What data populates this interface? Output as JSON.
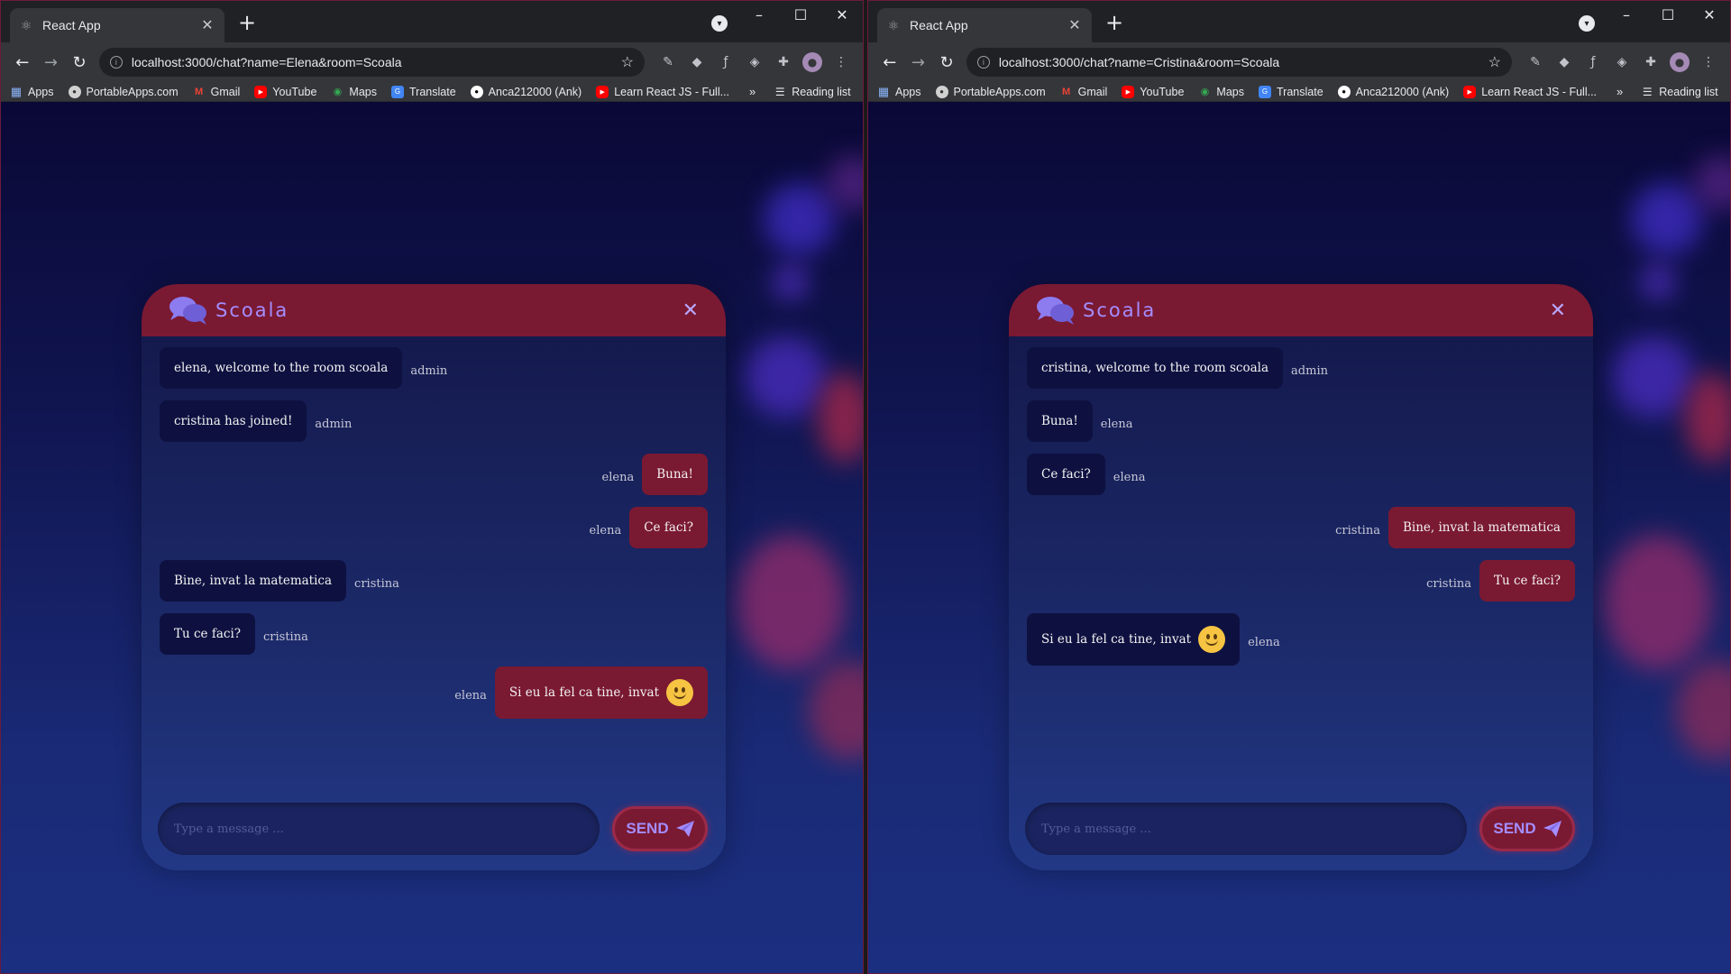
{
  "left": {
    "tab_title": "React App",
    "url": "localhost:3000/chat?name=Elena&room=Scoala",
    "bookmarks": [
      "Apps",
      "PortableApps.com",
      "Gmail",
      "YouTube",
      "Maps",
      "Translate",
      "Anca212000 (Ank)",
      "Learn React JS - Full..."
    ],
    "reading_list": "Reading list",
    "room": "Scoala",
    "messages": [
      {
        "text": "elena, welcome to the room scoala",
        "sender": "admin",
        "mine": false
      },
      {
        "text": "cristina has joined!",
        "sender": "admin",
        "mine": false
      },
      {
        "text": "Buna!",
        "sender": "elena",
        "mine": true
      },
      {
        "text": "Ce faci?",
        "sender": "elena",
        "mine": true
      },
      {
        "text": "Bine, invat la matematica",
        "sender": "cristina",
        "mine": false
      },
      {
        "text": "Tu ce faci?",
        "sender": "cristina",
        "mine": false
      },
      {
        "text": "Si eu la fel ca tine, invat",
        "sender": "elena",
        "mine": true,
        "emoji": "slightly-smiling-face"
      }
    ],
    "input_placeholder": "Type a message ...",
    "send_label": "SEND"
  },
  "right": {
    "tab_title": "React App",
    "url": "localhost:3000/chat?name=Cristina&room=Scoala",
    "bookmarks": [
      "Apps",
      "PortableApps.com",
      "Gmail",
      "YouTube",
      "Maps",
      "Translate",
      "Anca212000 (Ank)",
      "Learn React JS - Full..."
    ],
    "reading_list": "Reading list",
    "room": "Scoala",
    "messages": [
      {
        "text": "cristina, welcome to the room scoala",
        "sender": "admin",
        "mine": false
      },
      {
        "text": "Buna!",
        "sender": "elena",
        "mine": false
      },
      {
        "text": "Ce faci?",
        "sender": "elena",
        "mine": false
      },
      {
        "text": "Bine, invat la matematica",
        "sender": "cristina",
        "mine": true
      },
      {
        "text": "Tu ce faci?",
        "sender": "cristina",
        "mine": true
      },
      {
        "text": "Si eu la fel ca tine, invat",
        "sender": "elena",
        "mine": false,
        "emoji": "slightly-smiling-face"
      }
    ],
    "input_placeholder": "Type a message ...",
    "send_label": "SEND"
  },
  "colors": {
    "accent": "#7a1932",
    "room_title": "#a48dff",
    "bubble_other": "#0e1140"
  }
}
